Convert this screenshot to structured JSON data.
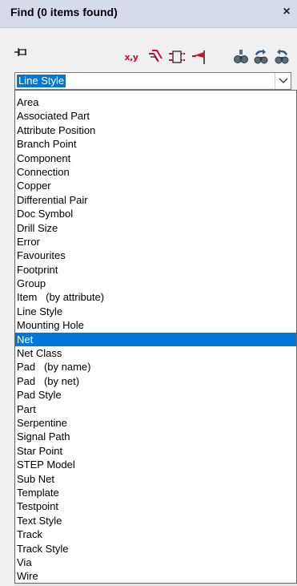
{
  "window": {
    "title": "Find (0 items found)",
    "close_glyph": "×"
  },
  "toolbar": {
    "pin_icon": "pin-icon",
    "xy_label": "x,y",
    "accent_color": "#c8102e",
    "buttons": [
      "xy-coordinate-icon",
      "select-net-icon",
      "component-outline-icon",
      "flag-icon",
      "find-icon",
      "find-previous-icon",
      "find-next-icon"
    ]
  },
  "find_type": {
    "selected": "Line Style",
    "highlight_color": "#0078d7",
    "options": [
      "Area",
      "Associated Part",
      "Attribute Position",
      "Branch Point",
      "Component",
      "Connection",
      "Copper",
      "Differential Pair",
      "Doc Symbol",
      "Drill Size",
      "Error",
      "Favourites",
      "Footprint",
      "Group",
      "Item   (by attribute)",
      "Line Style",
      "Mounting Hole",
      "Net",
      "Net Class",
      "Pad   (by name)",
      "Pad   (by net)",
      "Pad Style",
      "Part",
      "Serpentine",
      "Signal Path",
      "Star Point",
      "STEP Model",
      "Sub Net",
      "Template",
      "Testpoint",
      "Text Style",
      "Track",
      "Track Style",
      "Via",
      "Wire"
    ],
    "hovered_index": 17
  }
}
